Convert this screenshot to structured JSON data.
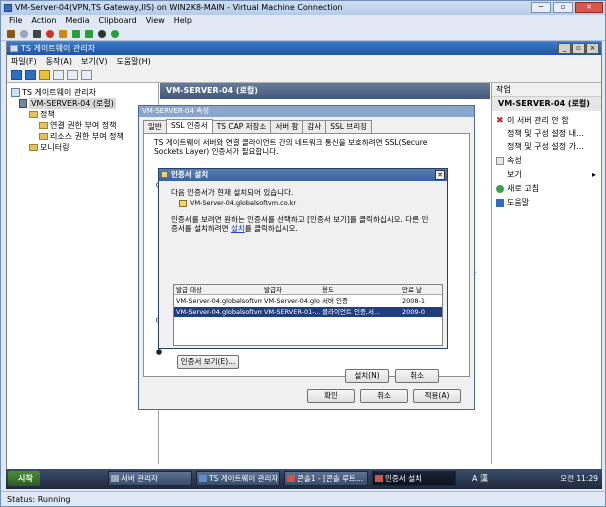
{
  "vm": {
    "title": "VM-Server-04(VPN,TS Gateway,IIS) on WIN2K8-MAIN - Virtual Machine Connection",
    "menu": [
      "File",
      "Action",
      "Media",
      "Clipboard",
      "View",
      "Help"
    ],
    "status": "Status: Running"
  },
  "mmc": {
    "title": "TS 게이트웨이 관리자",
    "menu": [
      "파일(F)",
      "동작(A)",
      "보기(V)",
      "도움말(H)"
    ],
    "ctrls": [
      "_",
      "▫",
      "×"
    ]
  },
  "tree": {
    "root": "TS 게이트웨이 관리자",
    "server": "VM-SERVER-04 (로컬)",
    "policy": "정책",
    "conn_policy": "연결 권한 부여 정책",
    "res_policy": "리소스 권한 부여 정책",
    "monitor": "모니터링"
  },
  "center": {
    "header": "VM-SERVER-04 (로컬)",
    "hint": "정 추"
  },
  "actions": {
    "title": "작업",
    "server": "VM-SERVER-04 (로컬)",
    "items": [
      "이 서버 관리 안 함",
      "정책 및 구성 설정 내...",
      "정책 및 구성 설정 가...",
      "속성",
      "보기",
      "새로 고침",
      "도움말"
    ]
  },
  "props": {
    "title": "VM-SERVER-04 속성",
    "tabs": [
      "일반",
      "SSL 인증서",
      "TS CAP 저장소",
      "서버 팜",
      "감사",
      "SSL 브리징"
    ],
    "desc": "TS 게이트웨이 서버와 연결 클라이언트 간의 네트워크 통신을 보호하려면 SSL(Secure Sockets Layer) 인증서가 필요합니다.",
    "ok": "확인",
    "cancel": "취소",
    "apply": "적용(A)"
  },
  "install": {
    "title": "인증서 설치",
    "line1": "다음 인증서가 현재 설치되어 있습니다.",
    "current_cert": "VM-Server-04.globalsoftvm.co.kr",
    "line2": "인증서를 보려면 원하는 인증서를 선택하고 [인증서 보기]를 클릭하십시오. 다른 인",
    "line3_pre": "증서를 설치하려면 ",
    "line3_link": "설치",
    "line3_post": "를 클릭하십시오.",
    "columns": [
      "발급 대상",
      "발급자",
      "용도",
      "만료 날"
    ],
    "rows": [
      [
        "VM-Server-04.globalsoftvm.co.kr",
        "VM-Server-04.glo...",
        "서버 인증",
        "2008-1"
      ],
      [
        "VM-Server-04.globalsoftvm.co.kr",
        "VM-SERVER-01-...",
        "클라이언트 인증,서...",
        "2009-0"
      ]
    ],
    "view_btn": "인증서 보기(E)...",
    "install_btn": "설치(N)",
    "cancel_btn": "취소"
  },
  "taskbar": {
    "start": "시작",
    "items": [
      "서버 관리자",
      "TS 게이트웨이 관리자",
      "콘솔1 - [콘솔 루트...",
      "인증서 설치"
    ],
    "lang": "A 漢",
    "clock": "오전 11:29"
  }
}
